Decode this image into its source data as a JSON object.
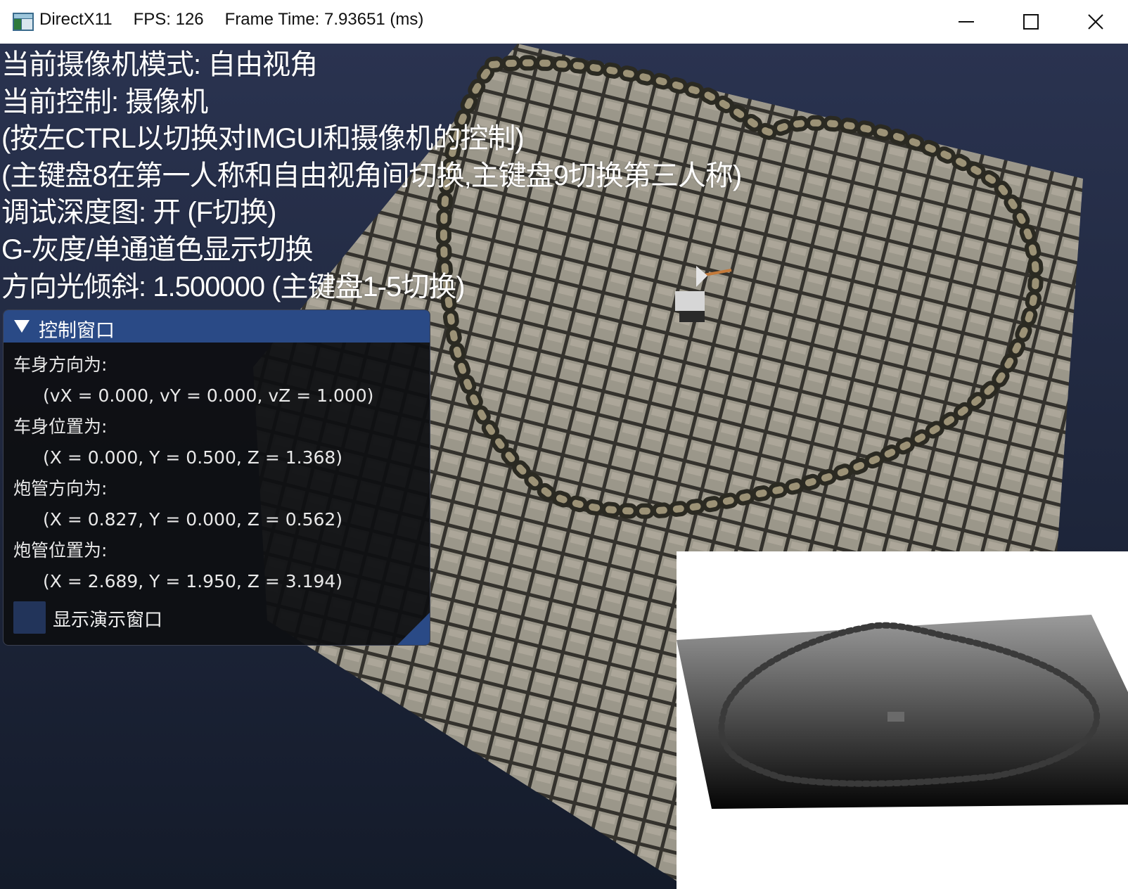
{
  "window": {
    "app_name": "DirectX11",
    "fps": "FPS: 126",
    "frame_time": "Frame Time: 7.93651 (ms)",
    "controls": {
      "minimize": "minimize-icon",
      "maximize": "maximize-icon",
      "close": "close-icon"
    }
  },
  "hud": {
    "lines": [
      "当前摄像机模式: 自由视角",
      "当前控制: 摄像机",
      "(按左CTRL以切换对IMGUI和摄像机的控制)",
      "(主键盘8在第一人称和自由视角间切换,主键盘9切换第三人称)",
      "调试深度图: 开 (F切换)",
      "G-灰度/单通道色显示切换",
      "方向光倾斜: 1.500000 (主键盘1-5切换)"
    ]
  },
  "control_window": {
    "title": "控制窗口",
    "body_direction_label": "车身方向为:",
    "body_direction_value": "(vX = 0.000, vY = 0.000, vZ = 1.000)",
    "body_position_label": "车身位置为:",
    "body_position_value": "(X = 0.000, Y = 0.500, Z = 1.368)",
    "barrel_direction_label": "炮管方向为:",
    "barrel_direction_value": "(X = 0.827, Y = 0.000, Z = 0.562)",
    "barrel_position_label": "炮管位置为:",
    "barrel_position_value": "(X = 2.689, Y = 1.950, Z = 3.194)",
    "demo_checkbox_label": "显示演示窗口",
    "demo_checkbox_checked": false
  },
  "colors": {
    "background": "#1b2232",
    "imgui_title": "#2a4a86",
    "imgui_bg": "#0e0f12",
    "checkbox": "#22345a"
  }
}
